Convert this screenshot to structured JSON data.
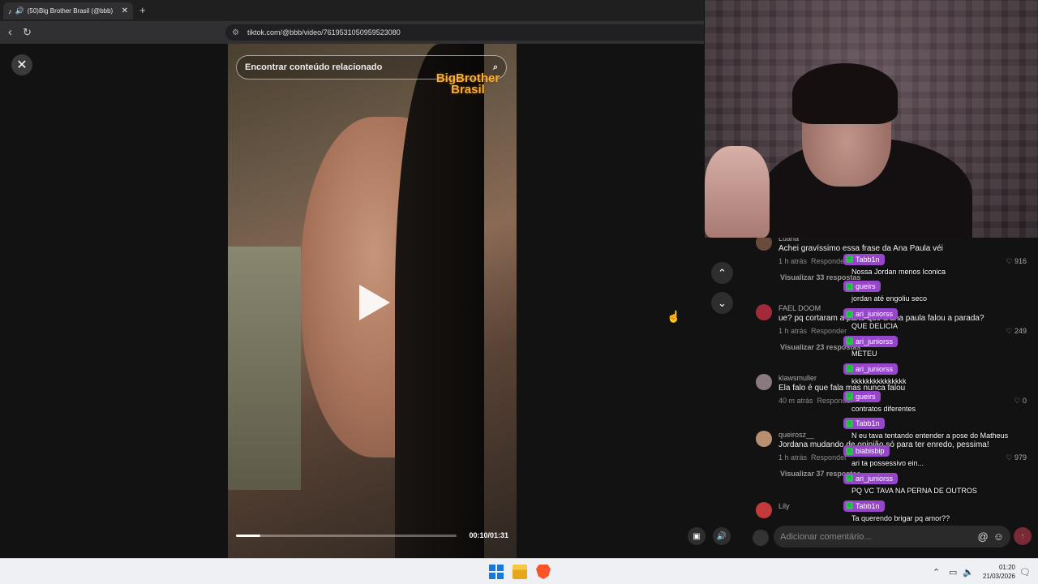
{
  "browser": {
    "tab_title": "(50)Big Brother Brasil (@bbb)",
    "tab_sound_icon": "speaker-icon",
    "new_tab": "+",
    "url": "tiktok.com/@bbb/video/7619531050959523080"
  },
  "video": {
    "search_placeholder": "Encontrar conteúdo relacionado",
    "logo_text": "BigBrother Brasil",
    "time_display": "00:10/01:31",
    "progress_fraction": 0.11
  },
  "comments": [
    {
      "user": "Luana",
      "text": "Achei gravíssimo essa frase da Ana Paula véi",
      "time": "1 h atrás",
      "reply": "Responder",
      "likes": "916",
      "replies_label": "Visualizar 33 respostas",
      "avatar_color": "#6a4a3a"
    },
    {
      "user": "FAEL DOOM",
      "text": "ue? pq cortaram a parte que a ana paula falou a parada?",
      "time": "1 h atrás",
      "reply": "Responder",
      "likes": "249",
      "replies_label": "Visualizar 23 respostas",
      "avatar_color": "#a32a3a"
    },
    {
      "user": "klawsmuller",
      "text": "Ela falo é que fala mas nunca falou",
      "time": "40 m atrás",
      "reply": "Responder",
      "likes": "0",
      "replies_label": "",
      "avatar_color": "#8a7a80"
    },
    {
      "user": "queirosz__",
      "text": "Jordana mudando de opinião só para ter enredo, pessima!",
      "time": "1 h atrás",
      "reply": "Responder",
      "likes": "979",
      "replies_label": "Visualizar 37 respostas",
      "avatar_color": "#b89070"
    },
    {
      "user": "Lily",
      "text": "",
      "time": "",
      "reply": "",
      "likes": "",
      "replies_label": "",
      "avatar_color": "#c23a3a"
    }
  ],
  "comment_input": {
    "placeholder": "Adicionar comentário..."
  },
  "chat": [
    {
      "user": "Tabb1n",
      "text": "Nossa Jordan menos Iconica"
    },
    {
      "user": "gueirs",
      "text": "jordan até engoliu seco"
    },
    {
      "user": "ari_juniorss",
      "text": "QUE DELICIA"
    },
    {
      "user": "ari_juniorss",
      "text": "METEU"
    },
    {
      "user": "ari_juniorss",
      "text": "kkkkkkkkkkkkkkk"
    },
    {
      "user": "gueirs",
      "text": "contratos diferentes"
    },
    {
      "user": "Tabb1n",
      "text": "N eu tava tentando entender a pose do Matheus"
    },
    {
      "user": "biabisbip",
      "text": "ari ta possessivo ein..."
    },
    {
      "user": "ari_juniorss",
      "text": "PQ VC TAVA NA PERNA DE OUTROS"
    },
    {
      "user": "Tabb1n",
      "text": "Ta querendo brigar pq amor??"
    }
  ],
  "taskbar": {
    "time": "01:20",
    "date": "21/03/2026"
  }
}
